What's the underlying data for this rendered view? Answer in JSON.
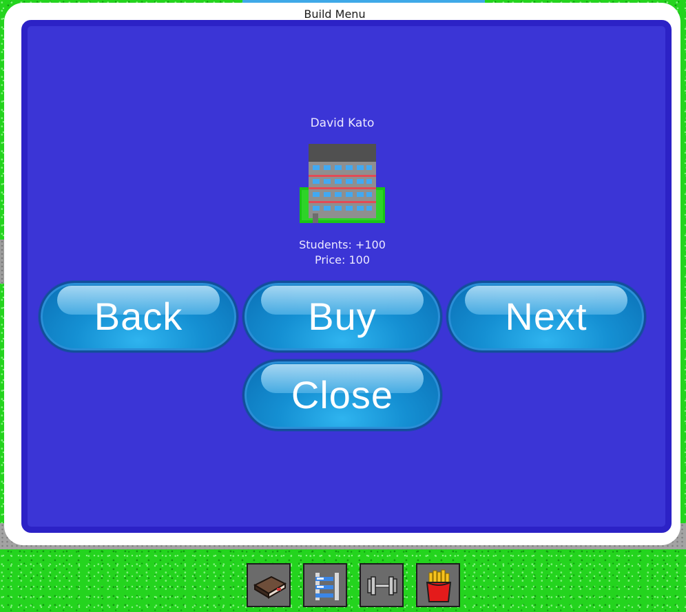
{
  "window": {
    "title": "Build Menu"
  },
  "building": {
    "name": "David Kato",
    "students": "Students: +100",
    "price": "Price: 100"
  },
  "buttons": {
    "back": "Back",
    "buy": "Buy",
    "next": "Next",
    "close": "Close"
  },
  "toolbar": {
    "items": [
      {
        "icon": "book-icon"
      },
      {
        "icon": "shelves-icon"
      },
      {
        "icon": "dumbbell-icon"
      },
      {
        "icon": "fries-icon"
      }
    ]
  },
  "colors": {
    "panel_fill": "#3b35d6",
    "panel_border": "#ffffff",
    "button": "#1590d3",
    "grass": "#24d41e"
  }
}
